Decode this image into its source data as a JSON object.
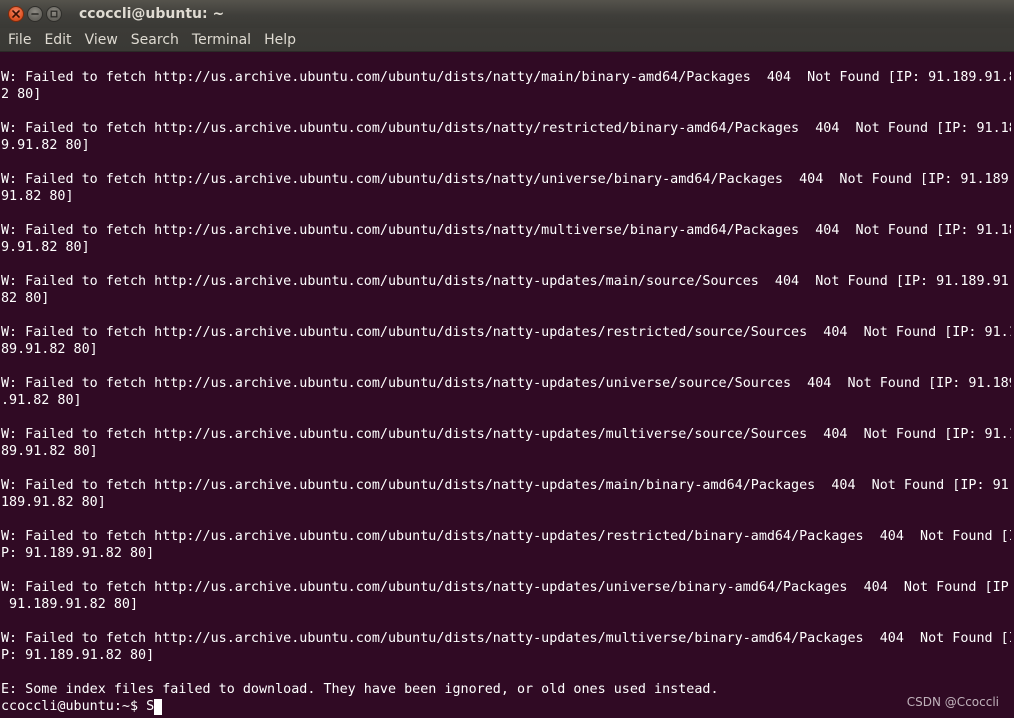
{
  "window": {
    "title": "ccoccli@ubuntu: ~"
  },
  "menu": {
    "items": [
      "File",
      "Edit",
      "View",
      "Search",
      "Terminal",
      "Help"
    ]
  },
  "terminal": {
    "lines": [
      "W: Failed to fetch http://us.archive.ubuntu.com/ubuntu/dists/natty/main/binary-amd64/Packages  404  Not Found [IP: 91.189.91.8",
      "2 80]",
      "",
      "W: Failed to fetch http://us.archive.ubuntu.com/ubuntu/dists/natty/restricted/binary-amd64/Packages  404  Not Found [IP: 91.18",
      "9.91.82 80]",
      "",
      "W: Failed to fetch http://us.archive.ubuntu.com/ubuntu/dists/natty/universe/binary-amd64/Packages  404  Not Found [IP: 91.189.",
      "91.82 80]",
      "",
      "W: Failed to fetch http://us.archive.ubuntu.com/ubuntu/dists/natty/multiverse/binary-amd64/Packages  404  Not Found [IP: 91.18",
      "9.91.82 80]",
      "",
      "W: Failed to fetch http://us.archive.ubuntu.com/ubuntu/dists/natty-updates/main/source/Sources  404  Not Found [IP: 91.189.91.",
      "82 80]",
      "",
      "W: Failed to fetch http://us.archive.ubuntu.com/ubuntu/dists/natty-updates/restricted/source/Sources  404  Not Found [IP: 91.1",
      "89.91.82 80]",
      "",
      "W: Failed to fetch http://us.archive.ubuntu.com/ubuntu/dists/natty-updates/universe/source/Sources  404  Not Found [IP: 91.189",
      ".91.82 80]",
      "",
      "W: Failed to fetch http://us.archive.ubuntu.com/ubuntu/dists/natty-updates/multiverse/source/Sources  404  Not Found [IP: 91.1",
      "89.91.82 80]",
      "",
      "W: Failed to fetch http://us.archive.ubuntu.com/ubuntu/dists/natty-updates/main/binary-amd64/Packages  404  Not Found [IP: 91.",
      "189.91.82 80]",
      "",
      "W: Failed to fetch http://us.archive.ubuntu.com/ubuntu/dists/natty-updates/restricted/binary-amd64/Packages  404  Not Found [I",
      "P: 91.189.91.82 80]",
      "",
      "W: Failed to fetch http://us.archive.ubuntu.com/ubuntu/dists/natty-updates/universe/binary-amd64/Packages  404  Not Found [IP:",
      " 91.189.91.82 80]",
      "",
      "W: Failed to fetch http://us.archive.ubuntu.com/ubuntu/dists/natty-updates/multiverse/binary-amd64/Packages  404  Not Found [I",
      "P: 91.189.91.82 80]",
      "",
      "E: Some index files failed to download. They have been ignored, or old ones used instead."
    ],
    "prompt": "ccoccli@ubuntu:~$ ",
    "input": "S"
  },
  "watermark": "CSDN @Ccoccli",
  "colors": {
    "terminal_bg": "#300a24",
    "terminal_fg": "#ffffff",
    "titlebar": "#3c3b37",
    "close_button": "#e25a2c"
  }
}
